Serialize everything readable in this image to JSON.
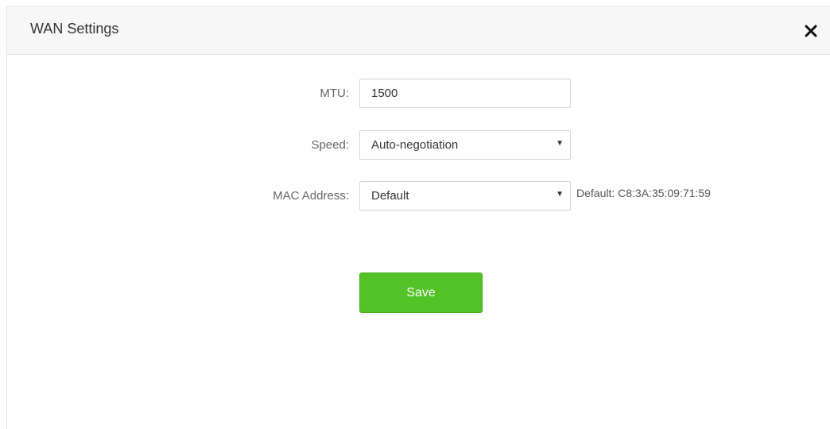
{
  "dialog": {
    "title": "WAN Settings",
    "close_icon": "close-icon"
  },
  "form": {
    "mtu": {
      "label": "MTU:",
      "value": "1500"
    },
    "speed": {
      "label": "Speed:",
      "selected": "Auto-negotiation"
    },
    "mac_address": {
      "label": "MAC Address:",
      "selected": "Default",
      "hint": "Default: C8:3A:35:09:71:59"
    },
    "save_label": "Save"
  },
  "colors": {
    "save_button": "#52c227",
    "header_background": "#f7f7f7"
  }
}
